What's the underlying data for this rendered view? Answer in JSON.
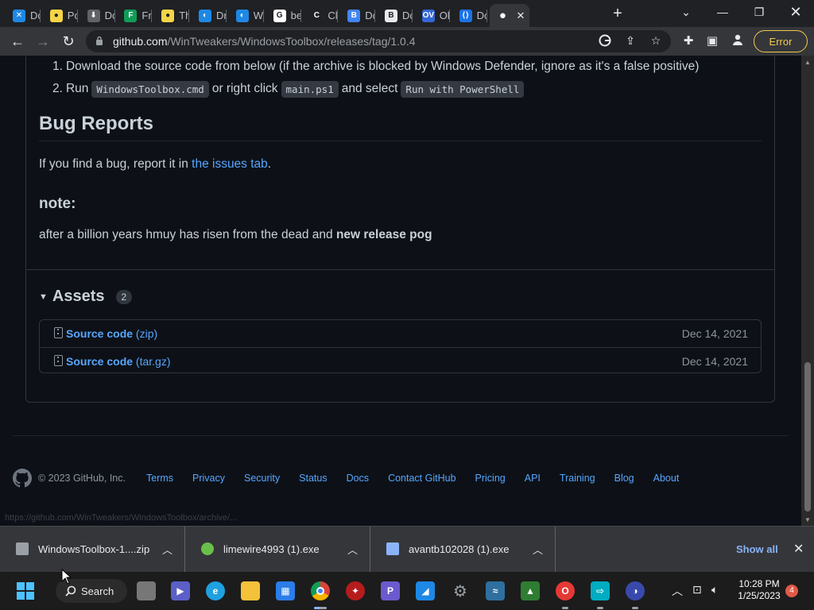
{
  "browser": {
    "tabs": [
      {
        "label": "Dc",
        "color": "#1e88e5",
        "glyph": "✕"
      },
      {
        "label": "Po",
        "color": "#f5d547",
        "glyph": "●"
      },
      {
        "label": "Dc",
        "color": "#5f6368",
        "glyph": "⬇"
      },
      {
        "label": "Fre",
        "color": "#0f9d58",
        "glyph": "F"
      },
      {
        "label": "Th",
        "color": "#f5d547",
        "glyph": "●"
      },
      {
        "label": "Dr",
        "color": "#1e88e5",
        "glyph": "◐"
      },
      {
        "label": "Wi",
        "color": "#1e88e5",
        "glyph": "◐"
      },
      {
        "label": "be",
        "color": "#ffffff",
        "glyph": "G"
      },
      {
        "label": "Cle",
        "color": "#202124",
        "glyph": "C"
      },
      {
        "label": "Dc",
        "color": "#4285f4",
        "glyph": "B"
      },
      {
        "label": "Dc",
        "color": "#e8eaed",
        "glyph": "B"
      },
      {
        "label": "Ol",
        "color": "#3367d6",
        "glyph": "OV"
      },
      {
        "label": "Dc",
        "color": "#1a73e8",
        "glyph": "⟨⟩"
      },
      {
        "label": "",
        "color": "#ffffff",
        "glyph": "●",
        "active": true
      }
    ],
    "url_host": "github.com",
    "url_path": "/WinTweakers/WindowsToolbox/releases/tag/1.0.4",
    "error_label": "Error"
  },
  "release": {
    "step1_prefix": "1.",
    "step1": "Download the source code from below (if the archive is blocked by Windows Defender, ignore as it's a false positive)",
    "step2_prefix": "2.",
    "step2_a": "Run",
    "step2_code1": "WindowsToolbox.cmd",
    "step2_b": "or right click",
    "step2_code2": "main.ps1",
    "step2_c": "and select",
    "step2_code3": "Run with PowerShell",
    "bug_heading": "Bug Reports",
    "bug_text_a": "If you find a bug, report it in ",
    "bug_link": "the issues tab",
    "bug_text_b": ".",
    "note_heading": "note:",
    "note_text_a": "after a billion years hmuy has risen from the dead and ",
    "note_text_bold": "new release pog"
  },
  "assets": {
    "title": "Assets",
    "count": "2",
    "items": [
      {
        "name": "Source code",
        "ext": "(zip)",
        "date": "Dec 14, 2021"
      },
      {
        "name": "Source code",
        "ext": "(tar.gz)",
        "date": "Dec 14, 2021"
      }
    ]
  },
  "footer": {
    "copyright": "© 2023 GitHub, Inc.",
    "links": [
      "Terms",
      "Privacy",
      "Security",
      "Status",
      "Docs",
      "Contact GitHub",
      "Pricing",
      "API",
      "Training",
      "Blog",
      "About"
    ],
    "status_url": "https://github.com/WinTweakers/WindowsToolbox/archive/..."
  },
  "downloads": {
    "items": [
      {
        "name": "WindowsToolbox-1....zip",
        "color": "#9aa0a6"
      },
      {
        "name": "limewire4993 (1).exe",
        "color": "#6abf4b"
      },
      {
        "name": "avantb102028 (1).exe",
        "color": "#8ab4f8"
      }
    ],
    "show_all": "Show all"
  },
  "taskbar": {
    "search_label": "Search",
    "time": "10:28 PM",
    "date": "1/25/2023",
    "notifications": "4"
  }
}
